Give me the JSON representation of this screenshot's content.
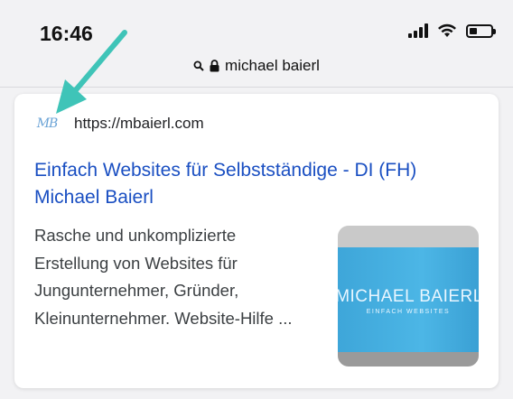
{
  "status": {
    "time": "16:46",
    "battery_level": 0.35
  },
  "browser": {
    "url_text": "michael baierl"
  },
  "result": {
    "favicon_text": "MB",
    "site_url": "https://mbaierl.com",
    "title": "Einfach Websites für Selbstständige - DI (FH) Michael Baierl",
    "snippet": "Rasche und unkomplizierte Erstellung von Websites für Jungunternehmer, Gründer, Kleinunternehmer. Website-Hilfe ...",
    "thumbnail": {
      "brand": "MICHAEL BAIERL",
      "tagline": "EINFACH WEBSITES"
    }
  },
  "colors": {
    "link": "#1a4fc2",
    "arrow": "#3fc4b8",
    "thumb_blue": "#3ea6d9"
  }
}
